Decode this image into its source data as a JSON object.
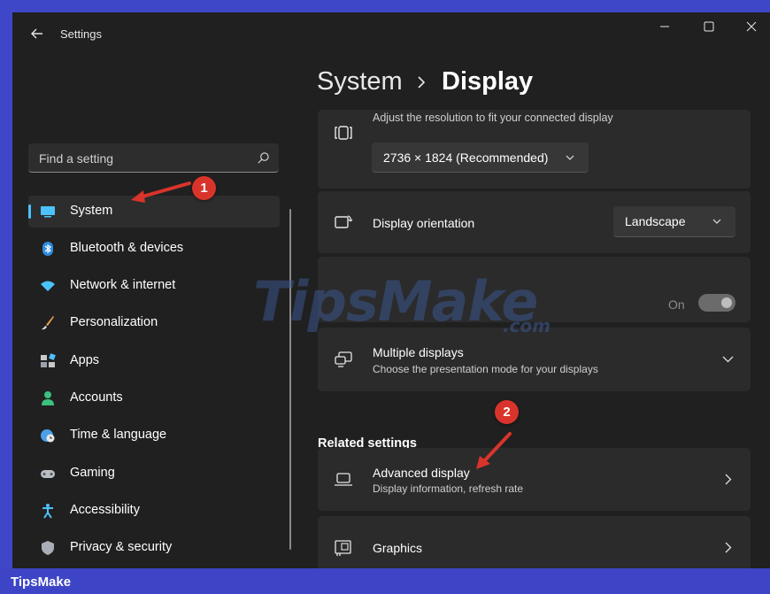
{
  "window": {
    "title": "Settings"
  },
  "search": {
    "placeholder": "Find a setting"
  },
  "sidebar": {
    "items": [
      {
        "label": "System",
        "icon": "monitor-icon"
      },
      {
        "label": "Bluetooth & devices",
        "icon": "bluetooth-icon"
      },
      {
        "label": "Network & internet",
        "icon": "wifi-icon"
      },
      {
        "label": "Personalization",
        "icon": "brush-icon"
      },
      {
        "label": "Apps",
        "icon": "apps-icon"
      },
      {
        "label": "Accounts",
        "icon": "person-icon"
      },
      {
        "label": "Time & language",
        "icon": "globe-clock-icon"
      },
      {
        "label": "Gaming",
        "icon": "gamepad-icon"
      },
      {
        "label": "Accessibility",
        "icon": "accessibility-icon"
      },
      {
        "label": "Privacy & security",
        "icon": "shield-icon"
      }
    ]
  },
  "breadcrumb": {
    "parent": "System",
    "current": "Display"
  },
  "resolution": {
    "subtitle": "Adjust the resolution to fit your connected display",
    "value": "2736 × 1824 (Recommended)"
  },
  "orientation": {
    "title": "Display orientation",
    "value": "Landscape"
  },
  "toggle_row": {
    "state_label": "On"
  },
  "multiple_displays": {
    "title": "Multiple displays",
    "subtitle": "Choose the presentation mode for your displays"
  },
  "related": {
    "heading": "Related settings"
  },
  "advanced_display": {
    "title": "Advanced display",
    "subtitle": "Display information, refresh rate"
  },
  "graphics": {
    "title": "Graphics"
  },
  "annotations": {
    "badge_1": "1",
    "badge_2": "2"
  },
  "watermark": {
    "main": "TipsMake",
    "suffix": ".com"
  },
  "footer": {
    "brand": "TipsMake"
  },
  "colors": {
    "accent": "#4cc2ff",
    "badge": "#d9342b",
    "window_bg": "#202020",
    "card_bg": "#2b2b2b",
    "frame": "#3f47c9"
  }
}
